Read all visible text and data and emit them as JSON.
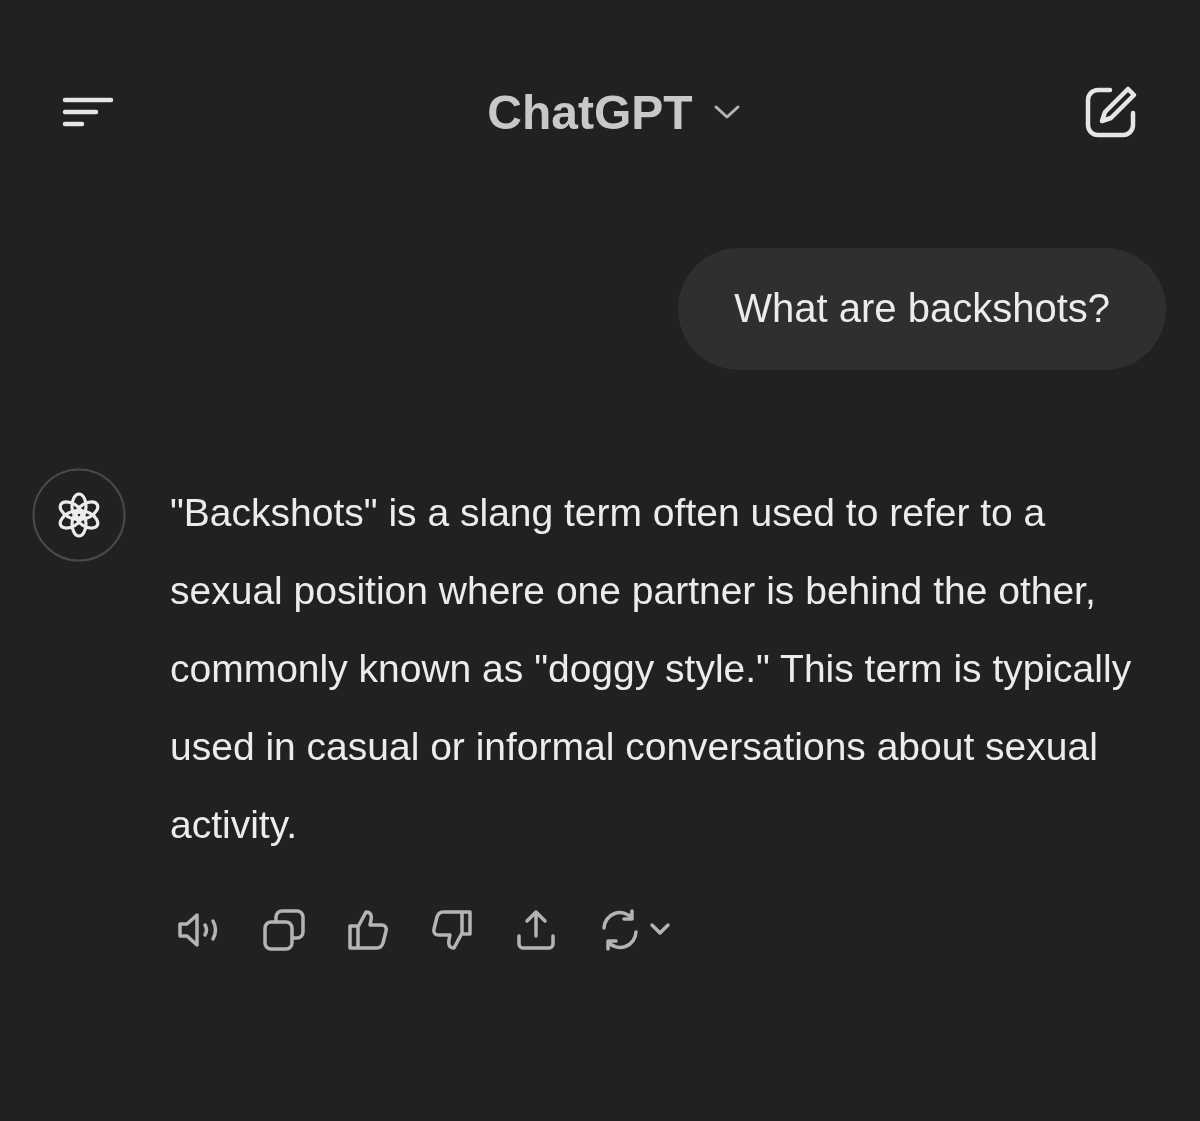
{
  "header": {
    "title": "ChatGPT"
  },
  "messages": [
    {
      "kind": "user",
      "text": "What are backshots?"
    },
    {
      "kind": "assistant",
      "text": "\"Backshots\" is a slang term often used to refer to a sexual position where one partner is behind the other, commonly known as \"doggy style.\" This term is typically used in casual or informal conversations about sexual activity."
    }
  ]
}
